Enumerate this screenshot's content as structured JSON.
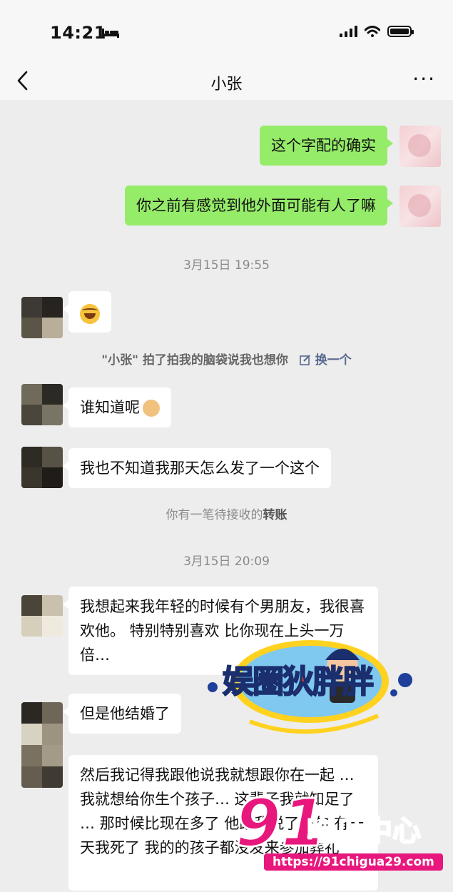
{
  "status": {
    "time": "14:21"
  },
  "nav": {
    "back_icon": "chevron-left-icon",
    "title": "小张",
    "more": "···"
  },
  "messages": {
    "m1": "这个字配的确实",
    "m2": "你之前有感觉到他外面可能有人了嘛",
    "ts1": "3月15日 19:55",
    "pat_text": "\"小张\" 拍了拍我的脑袋说我也想你",
    "pat_action": "换一个",
    "m4": "谁知道呢",
    "m5": "我也不知道我那天怎么发了一个这个",
    "transfer_prefix": "你有一笔待接收的",
    "transfer_link": "转账",
    "ts2": "3月15日 20:09",
    "m6": "我想起来我年轻的时候有个男朋友，我很喜欢他。 特别特别喜欢 比你现在上头一万倍…",
    "m7": "但是他结婚了",
    "m8": "然后我记得我跟他说我就想跟你在一起 … 我就想给你生个孩子… 这辈子我就知足了 … 那时候比现在多了 他跟我说了一句 有一天我死了 我的的孩子都没发来参加葬礼"
  },
  "watermark": {
    "logo_text": "娱圈狄胖胖",
    "brand_number": "91",
    "brand_text": "吃瓜中心",
    "url": "https://91chigua29.com"
  },
  "colors": {
    "chat_bg": "#ededed",
    "my_bubble": "#95ec69",
    "other_bubble": "#ffffff",
    "brand_pink": "#e8177d"
  }
}
